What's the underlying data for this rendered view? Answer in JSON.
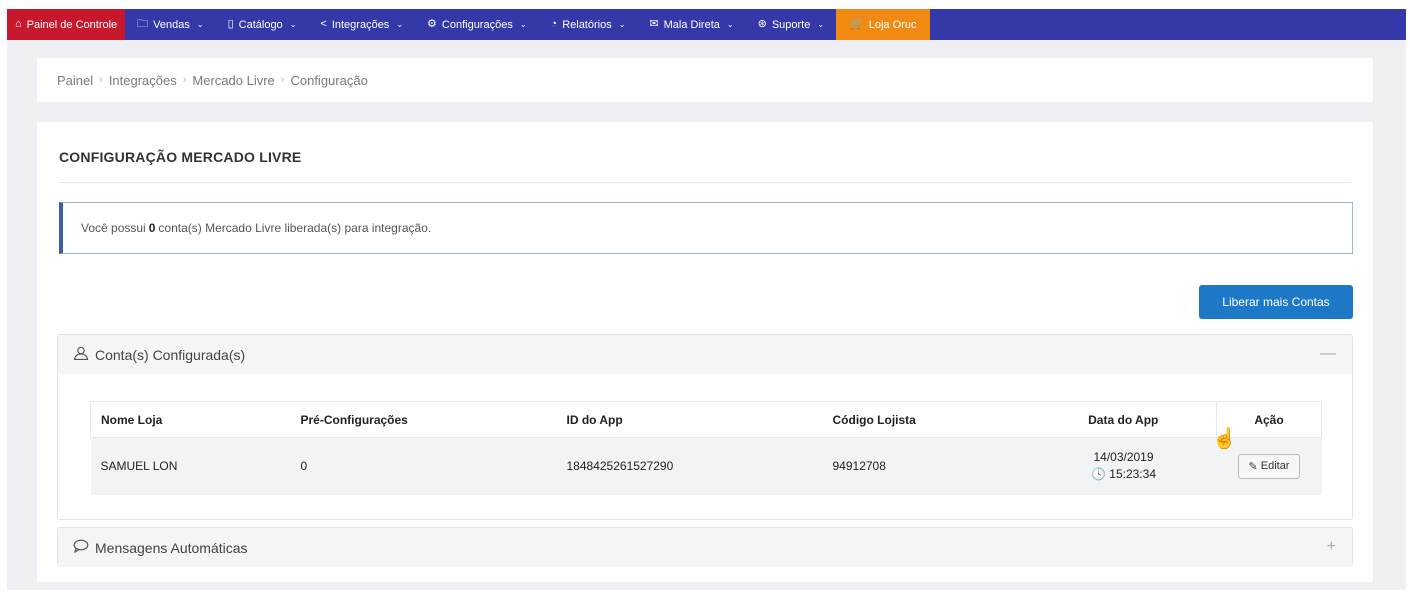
{
  "nav": {
    "items": [
      {
        "label": "Painel de Controle",
        "icon": "⌂",
        "icon_name": "home-icon",
        "has_chevron": false
      },
      {
        "label": "Vendas",
        "icon": "🗀",
        "icon_name": "folder-icon",
        "has_chevron": true
      },
      {
        "label": "Catálogo",
        "icon": "▯",
        "icon_name": "book-icon",
        "has_chevron": true
      },
      {
        "label": "Integrações",
        "icon": "<",
        "icon_name": "share-icon",
        "has_chevron": true
      },
      {
        "label": "Configurações",
        "icon": "⚙",
        "icon_name": "gear-icon",
        "has_chevron": true
      },
      {
        "label": "Relatórios",
        "icon": "◔",
        "icon_name": "chart-icon",
        "has_chevron": true
      },
      {
        "label": "Mala Direta",
        "icon": "✉",
        "icon_name": "mail-icon",
        "has_chevron": true
      },
      {
        "label": "Suporte",
        "icon": "⊛",
        "icon_name": "support-icon",
        "has_chevron": true
      },
      {
        "label": "Loja Oruc",
        "icon": "🛒",
        "icon_name": "cart-icon",
        "has_chevron": false
      }
    ],
    "colors": {
      "bar": "#3438a8",
      "active": "#c8182e",
      "store": "#f08a12"
    }
  },
  "breadcrumb": [
    "Painel",
    "Integrações",
    "Mercado Livre",
    "Configuração"
  ],
  "card": {
    "title": "CONFIGURAÇÃO MERCADO LIVRE",
    "alert_prefix": "Você possui",
    "alert_count": "0",
    "alert_suffix": "conta(s) Mercado Livre liberada(s) para integração.",
    "button_label": "Liberar mais Contas"
  },
  "panel_accounts": {
    "title": "Conta(s) Configurada(s)",
    "toggle": "—",
    "columns": [
      "Nome Loja",
      "Pré-Configurações",
      "ID do App",
      "Código Lojista",
      "Data do App",
      "Ação"
    ],
    "rows": [
      {
        "nome": "SAMUEL LON",
        "pre": "0",
        "id_app": "1848425261527290",
        "codigo": "94912708",
        "data": "14/03/2019",
        "hora": "15:23:34",
        "acao": "Editar"
      }
    ]
  },
  "panel_messages": {
    "title": "Mensagens Automáticas",
    "toggle": "+"
  }
}
